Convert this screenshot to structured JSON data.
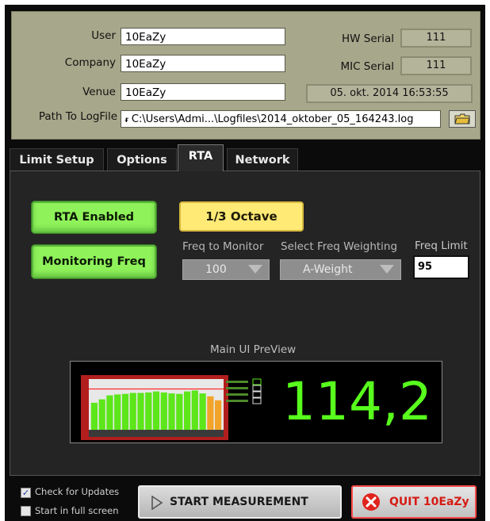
{
  "info": {
    "user_label": "User",
    "user_value": "10EaZy",
    "company_label": "Company",
    "company_value": "10EaZy",
    "venue_label": "Venue",
    "venue_value": "10EaZy",
    "path_label": "Path To LogFile",
    "path_prefix": "%",
    "path_value": "C:\\Users\\Admi...\\Logfiles\\2014_oktober_05_164243.log",
    "hw_serial_label": "HW Serial",
    "hw_serial_value": "111",
    "mic_serial_label": "MIC Serial",
    "mic_serial_value": "111",
    "datetime": "05. okt.  2014 16:53:55"
  },
  "tabs": [
    {
      "label": "Limit Setup"
    },
    {
      "label": "Options"
    },
    {
      "label": "RTA"
    },
    {
      "label": "Network"
    }
  ],
  "active_tab": "RTA",
  "rta": {
    "enabled_label": "RTA Enabled",
    "octave_label": "1/3 Octave",
    "monitoring_label": "Monitoring Freq",
    "freq_monitor_caption": "Freq to Monitor",
    "freq_monitor_value": "100",
    "weighting_caption": "Select Freq Weighting",
    "weighting_value": "A-Weight",
    "freq_limit_caption": "Freq Limit",
    "freq_limit_value": "95"
  },
  "preview": {
    "caption": "Main UI PreView",
    "reading": "114,2",
    "bar_levels": [
      0.55,
      0.62,
      0.7,
      0.72,
      0.73,
      0.75,
      0.75,
      0.76,
      0.78,
      0.76,
      0.74,
      0.73,
      0.78,
      0.8,
      0.74,
      0.68,
      0.6
    ],
    "limit_level": 0.83
  },
  "options": {
    "check_updates_label": "Check for Updates",
    "check_updates_checked": true,
    "full_screen_label": "Start in full screen",
    "full_screen_checked": false
  },
  "actions": {
    "start_label": "START MEASUREMENT",
    "quit_label": "QUIT 10EaZy"
  },
  "colors": {
    "accent_green": "#58ff1c",
    "button_green": "#8ff25a",
    "button_yellow": "#ffea76",
    "quit_red": "#e0241d"
  }
}
